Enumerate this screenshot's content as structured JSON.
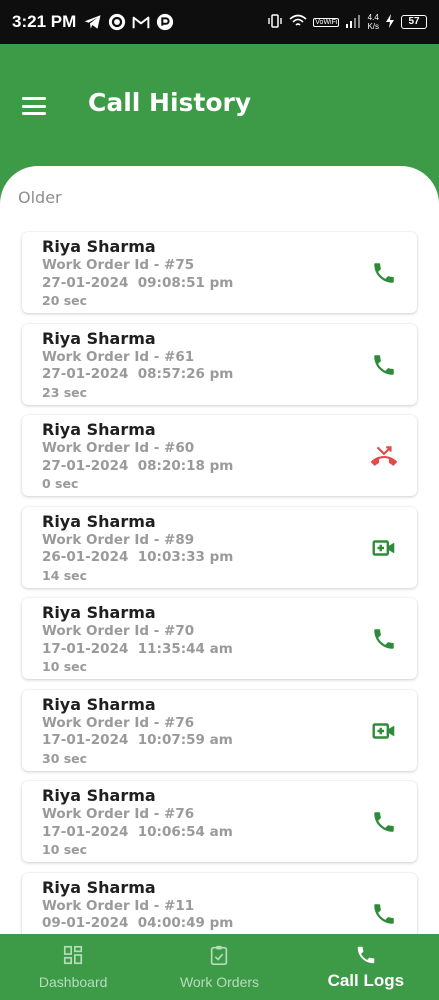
{
  "status_bar": {
    "time": "3:21 PM",
    "left_icons": [
      "telegram-icon",
      "circle-app-icon",
      "gmail-icon",
      "app-icon"
    ],
    "net_speed_top": "4.4",
    "net_speed_bottom": "K/s",
    "battery": "57",
    "wifi_label": "VoWiFi"
  },
  "header": {
    "title": "Call History",
    "menu_icon": "hamburger-icon"
  },
  "section": {
    "label": "Older"
  },
  "calls": [
    {
      "name": "Riya Sharma",
      "work_order": "Work Order Id - #75",
      "datetime": "27-01-2024  09:08:51 pm",
      "duration": "20 sec",
      "type": "phone-icon",
      "color": "#2e8b3a"
    },
    {
      "name": "Riya Sharma",
      "work_order": "Work Order Id - #61",
      "datetime": "27-01-2024  08:57:26 pm",
      "duration": "23 sec",
      "type": "phone-icon",
      "color": "#2e8b3a"
    },
    {
      "name": "Riya Sharma",
      "work_order": "Work Order Id - #60",
      "datetime": "27-01-2024  08:20:18 pm",
      "duration": "0 sec",
      "type": "missed-call-icon",
      "color": "#e24b4b"
    },
    {
      "name": "Riya Sharma",
      "work_order": "Work Order Id - #89",
      "datetime": "26-01-2024  10:03:33 pm",
      "duration": "14 sec",
      "type": "video-call-icon",
      "color": "#2e8b3a"
    },
    {
      "name": "Riya Sharma",
      "work_order": "Work Order Id - #70",
      "datetime": "17-01-2024  11:35:44 am",
      "duration": "10 sec",
      "type": "phone-icon",
      "color": "#2e8b3a"
    },
    {
      "name": "Riya Sharma",
      "work_order": "Work Order Id - #76",
      "datetime": "17-01-2024  10:07:59 am",
      "duration": "30 sec",
      "type": "video-call-icon",
      "color": "#2e8b3a"
    },
    {
      "name": "Riya Sharma",
      "work_order": "Work Order Id - #76",
      "datetime": "17-01-2024  10:06:54 am",
      "duration": "10 sec",
      "type": "phone-icon",
      "color": "#2e8b3a"
    },
    {
      "name": "Riya Sharma",
      "work_order": "Work Order Id - #11",
      "datetime": "09-01-2024  04:00:49 pm",
      "duration": "",
      "type": "phone-icon",
      "color": "#2e8b3a"
    }
  ],
  "bottom_nav": {
    "items": [
      {
        "label": "Dashboard",
        "icon": "dashboard-icon",
        "active": false
      },
      {
        "label": "Work Orders",
        "icon": "clipboard-check-icon",
        "active": false
      },
      {
        "label": "Call Logs",
        "icon": "phone-icon",
        "active": true
      }
    ]
  },
  "colors": {
    "brand_green": "#3d9a47",
    "icon_green": "#2e8b3a",
    "missed_red": "#e24b4b",
    "muted_text": "#9a9a9a"
  }
}
